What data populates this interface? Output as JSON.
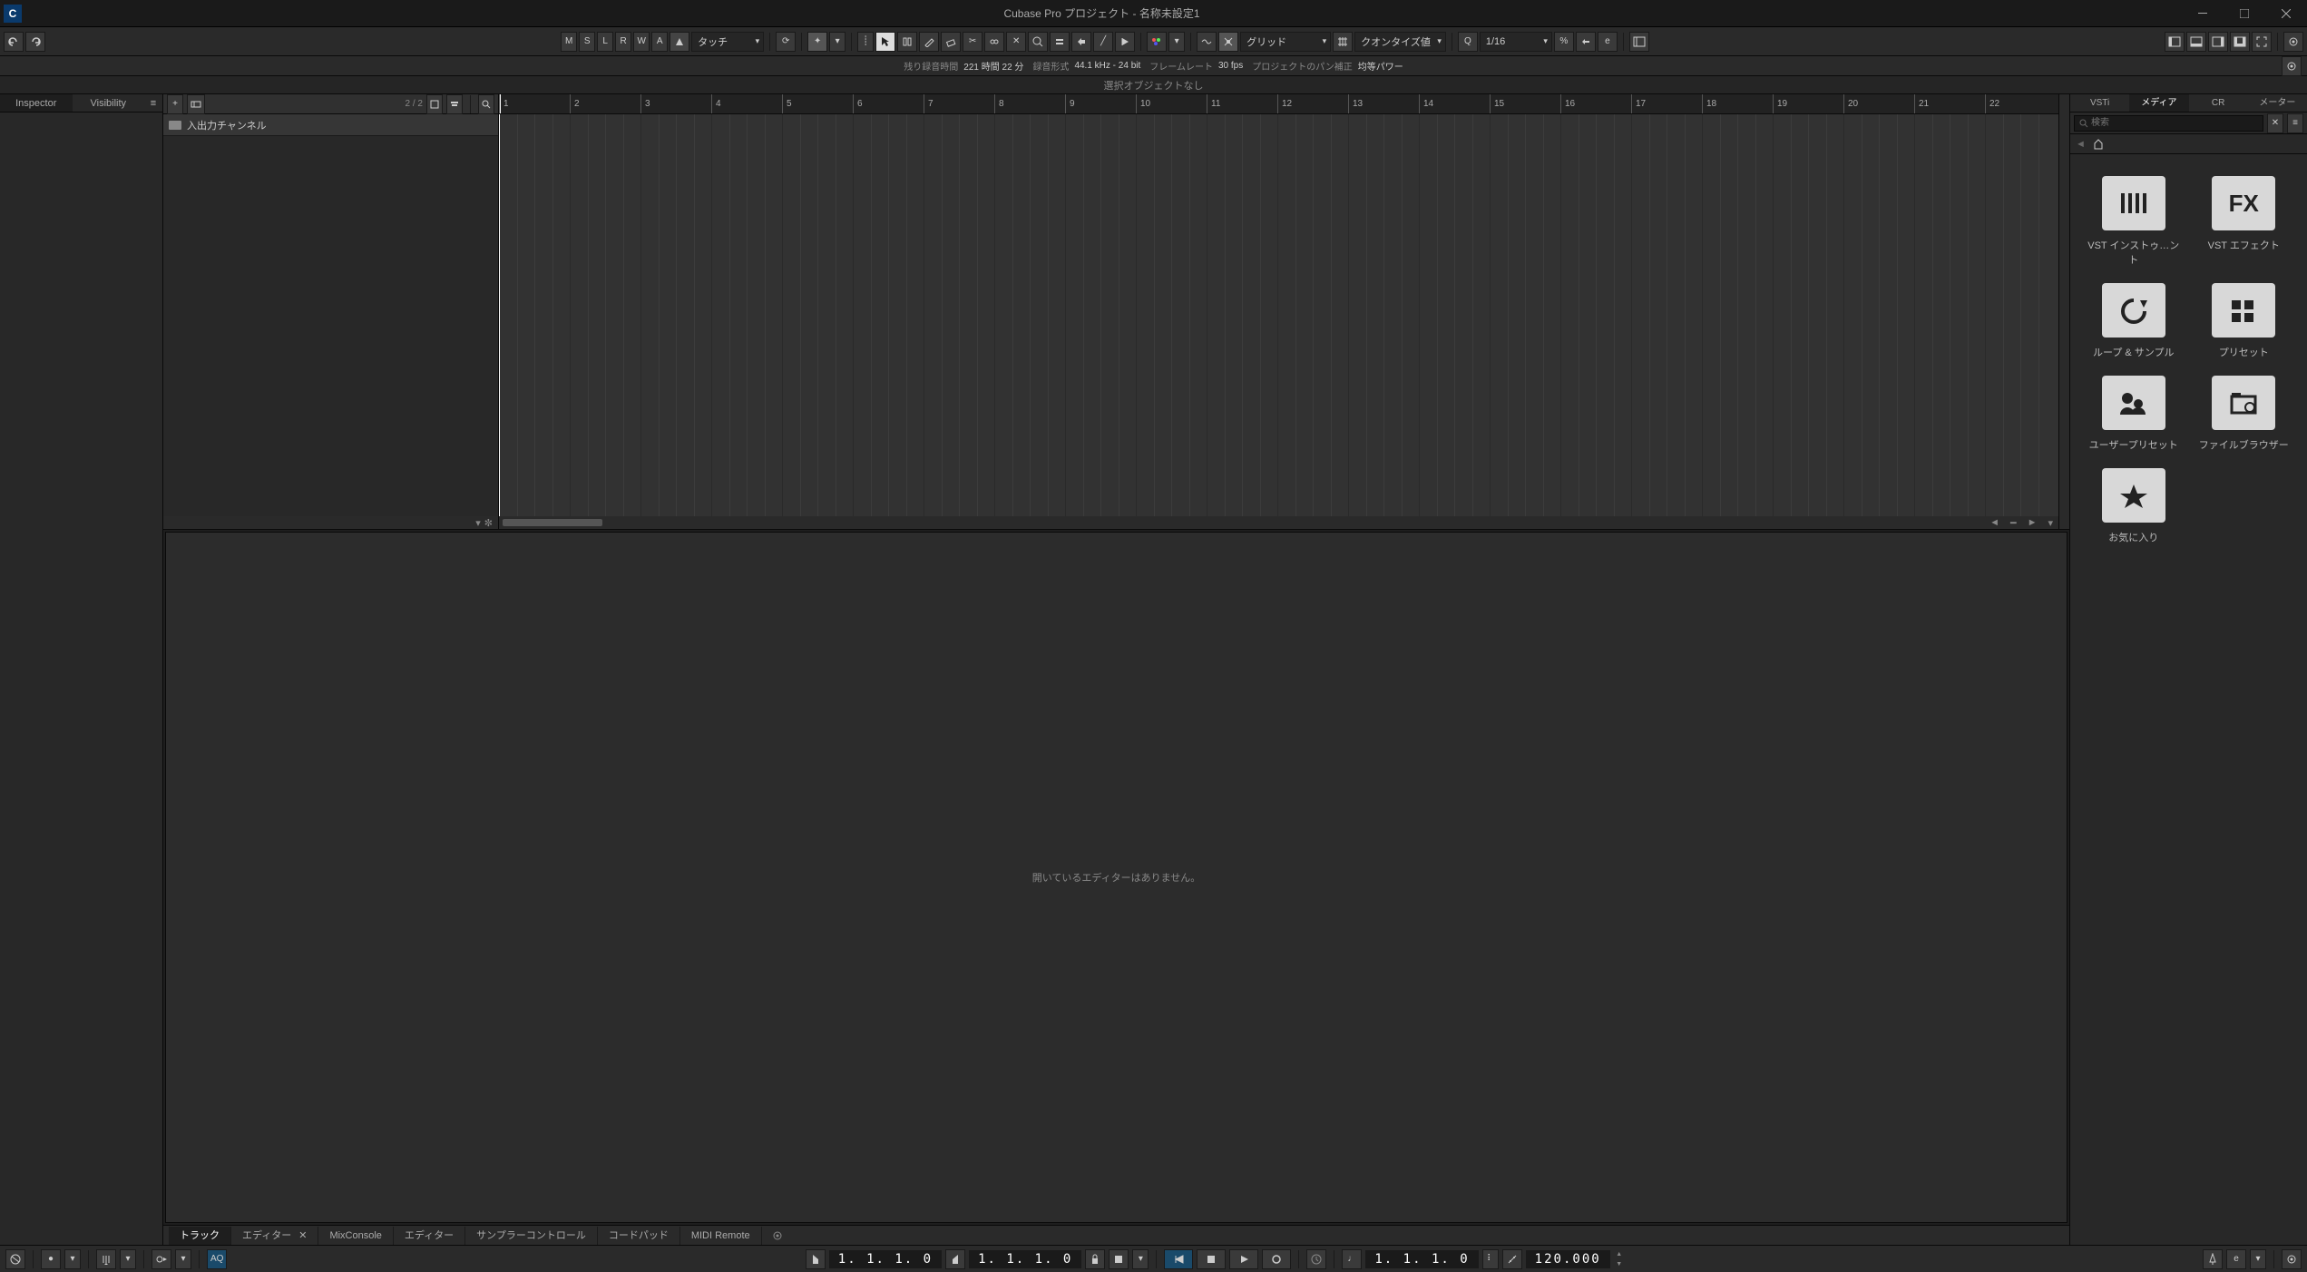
{
  "titlebar": {
    "app_short": "C",
    "title": "Cubase Pro プロジェクト - 名称未設定1"
  },
  "toolbar": {
    "m": "M",
    "s": "S",
    "l": "L",
    "r": "R",
    "w": "W",
    "a": "A",
    "automation_mode": "タッチ",
    "grid_label": "グリッド",
    "quantize_label": "クオンタイズ値",
    "quantize_value": "1/16"
  },
  "infobar": {
    "remain_label": "残り録音時間",
    "remain_value": "221 時間 22 分",
    "format_label": "録音形式",
    "format_value": "44.1 kHz - 24 bit",
    "frame_label": "フレームレート",
    "frame_value": "30 fps",
    "pan_label": "プロジェクトのパン補正",
    "pan_value": "均等パワー"
  },
  "selectbar": {
    "text": "選択オブジェクトなし"
  },
  "left_tabs": {
    "inspector": "Inspector",
    "visibility": "Visibility"
  },
  "track": {
    "count": "2 / 2",
    "name": "入出力チャンネル"
  },
  "ruler": {
    "bars": [
      1,
      2,
      3,
      4,
      5,
      6,
      7,
      8,
      9,
      10,
      11,
      12,
      13,
      14,
      15,
      16,
      17,
      18,
      19,
      20,
      21,
      22
    ]
  },
  "editor": {
    "empty_text": "開いているエディターはありません。"
  },
  "right_tabs": {
    "vsti": "VSTi",
    "media": "メディア",
    "cr": "CR",
    "meter": "メーター"
  },
  "search": {
    "placeholder": "検索"
  },
  "media": {
    "items": [
      {
        "icon": "vsti",
        "label": "VST インストゥ…ント"
      },
      {
        "icon": "fx",
        "label": "VST エフェクト"
      },
      {
        "icon": "loop",
        "label": "ループ & サンプル"
      },
      {
        "icon": "preset",
        "label": "プリセット"
      },
      {
        "icon": "user",
        "label": "ユーザープリセット"
      },
      {
        "icon": "file",
        "label": "ファイルブラウザー"
      },
      {
        "icon": "fav",
        "label": "お気に入り"
      }
    ]
  },
  "bottom_tabs": {
    "track": "トラック",
    "editor": "エディター",
    "mix": "MixConsole",
    "editor2": "エディター",
    "sampler": "サンプラーコントロール",
    "chord": "コードパッド",
    "midi": "MIDI Remote"
  },
  "transport": {
    "aq": "AQ",
    "pos1": "1. 1. 1.  0",
    "pos2": "1. 1. 1.  0",
    "pos3": "1. 1. 1.  0",
    "tempo": "120.000"
  }
}
